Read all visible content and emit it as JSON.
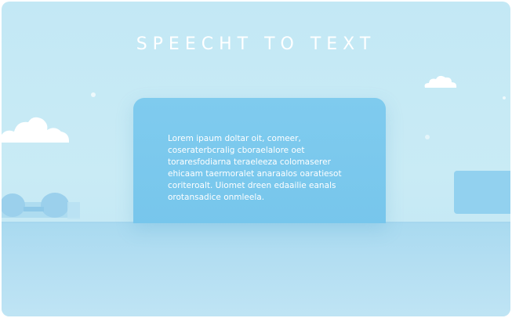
{
  "header": {
    "title": "SPEECHT TO TEXT"
  },
  "card": {
    "text": "Lorem ipaum doltar oit, comeer, coseraterbcralig cboraelalore oet toraresfodiarna teraeleeza colomaserer ehicaam taermoralet anaraalos oaratiesot coriteroalt. Uiomet dreen edaailie eanals orotansadice onmleela."
  },
  "icons": {
    "left_cloud": "cloud-icon",
    "right_cloud": "cloud-icon",
    "lounge": "lounge-chairs-icon"
  },
  "colors": {
    "background": "#c5e9f5",
    "card": "#7cc9ed",
    "floor": "#aedcf1",
    "text": "#ffffff"
  }
}
